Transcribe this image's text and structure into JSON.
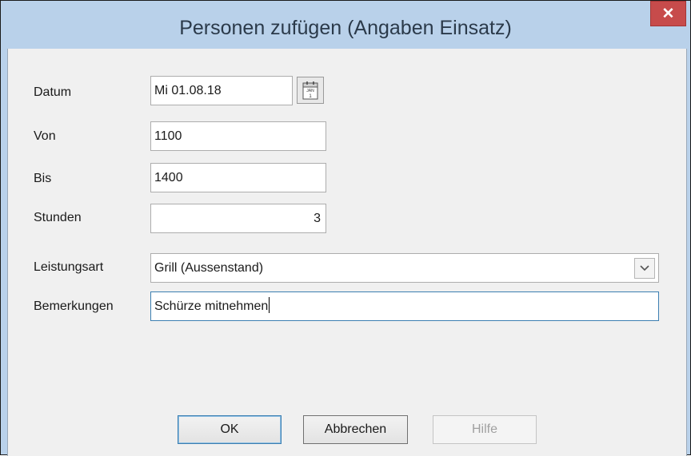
{
  "window": {
    "title": "Personen zufügen (Angaben Einsatz)",
    "close_symbol": "✕"
  },
  "form": {
    "datum": {
      "label": "Datum",
      "value": "Mi 01.08.18",
      "calendar_icon": "calendar-icon",
      "calendar_text": "JAN",
      "calendar_day": "1"
    },
    "von": {
      "label": "Von",
      "value": "1100"
    },
    "bis": {
      "label": "Bis",
      "value": "1400"
    },
    "stunden": {
      "label": "Stunden",
      "value": "3"
    },
    "leistungsart": {
      "label": "Leistungsart",
      "value": "Grill (Aussenstand)"
    },
    "bemerkungen": {
      "label": "Bemerkungen",
      "value": "Schürze mitnehmen"
    }
  },
  "buttons": {
    "ok": "OK",
    "cancel": "Abbrechen",
    "help": "Hilfe"
  },
  "colors": {
    "title_bar": "#b9d1ea",
    "close_button": "#c74b4b",
    "focus_border": "#3c7fb1",
    "dialog_background": "#f0f0f0"
  }
}
